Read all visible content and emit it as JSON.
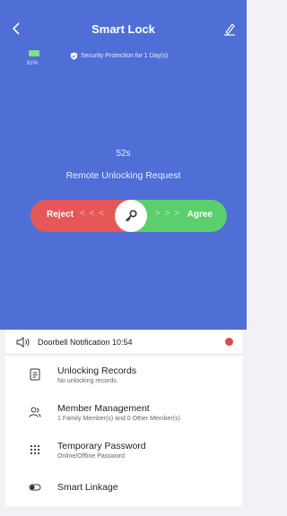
{
  "header": {
    "title": "Smart Lock"
  },
  "status": {
    "battery": "81%",
    "security": "Security Protection for 1 Day(s)"
  },
  "request": {
    "timer": "52s",
    "text": "Remote Unlocking Request",
    "reject_label": "Reject",
    "agree_label": "Agree",
    "arrows_left": "< < <",
    "arrows_right": "> > >"
  },
  "notification": {
    "text": "Doorbell Notification 10:54"
  },
  "menu": [
    {
      "label": "Unlocking Records",
      "sub": "No unlocking records."
    },
    {
      "label": "Member Management",
      "sub": "1 Family Member(s) and 0 Other Member(s)"
    },
    {
      "label": "Temporary Password",
      "sub": "Online/Offline Password"
    },
    {
      "label": "Smart Linkage",
      "sub": ""
    }
  ],
  "colors": {
    "hero": "#4f6fd6",
    "reject": "#e65858",
    "agree": "#5ccf6d",
    "badge": "#e0474c"
  }
}
